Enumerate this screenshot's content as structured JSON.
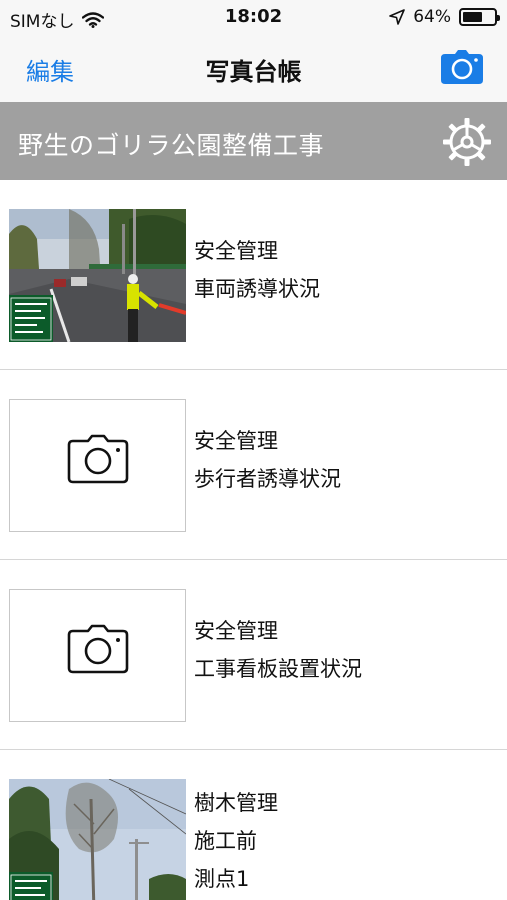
{
  "status_bar": {
    "carrier": "SIMなし",
    "time": "18:02",
    "battery_percent": "64%",
    "battery_level": 0.64
  },
  "nav": {
    "edit_label": "編集",
    "title": "写真台帳",
    "camera_icon": "camera-icon"
  },
  "project": {
    "title": "野生のゴリラ公園整備工事",
    "settings_icon": "gear-icon"
  },
  "items": [
    {
      "category": "安全管理",
      "description": "車両誘導状況",
      "extra": "",
      "has_photo": true
    },
    {
      "category": "安全管理",
      "description": "歩行者誘導状況",
      "extra": "",
      "has_photo": false
    },
    {
      "category": "安全管理",
      "description": "工事看板設置状況",
      "extra": "",
      "has_photo": false
    },
    {
      "category": "樹木管理",
      "description": "施工前",
      "extra": "測点1",
      "has_photo": true
    }
  ],
  "colors": {
    "accent": "#1a7de6",
    "project_header_bg": "#a0a0a0"
  }
}
